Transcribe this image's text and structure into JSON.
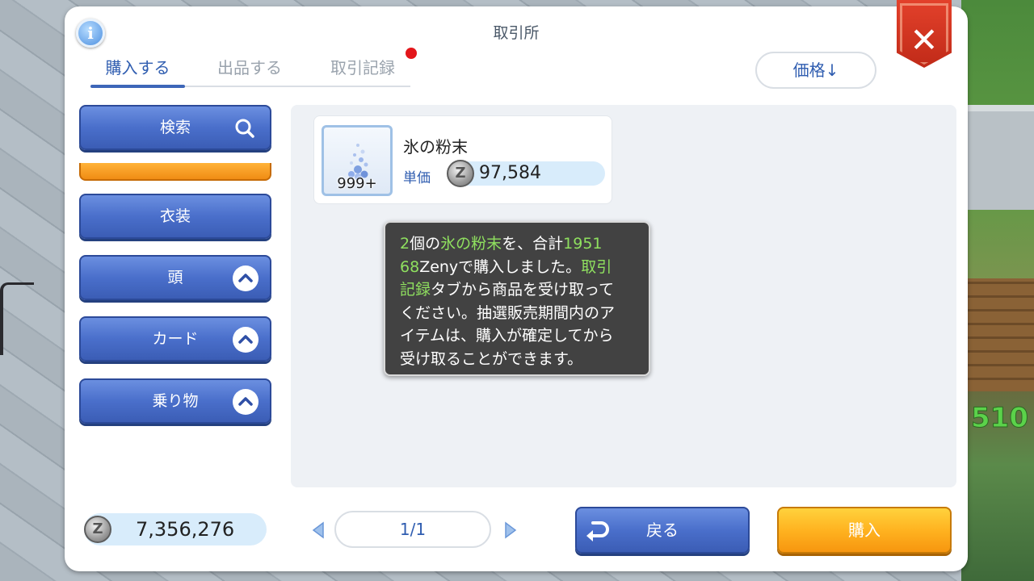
{
  "window": {
    "title": "取引所",
    "close_symbol": "✕",
    "info_symbol": "i"
  },
  "tabs": [
    {
      "label": "購入する",
      "active": true
    },
    {
      "label": "出品する",
      "active": false
    },
    {
      "label": "取引記録",
      "active": false,
      "has_notification": true
    }
  ],
  "sort": {
    "label": "価格↓"
  },
  "sidebar": {
    "search_label": "検索",
    "categories": [
      {
        "label": "衣装",
        "expandable": false
      },
      {
        "label": "頭",
        "expandable": true
      },
      {
        "label": "カード",
        "expandable": true
      },
      {
        "label": "乗り物",
        "expandable": true
      }
    ]
  },
  "listing": {
    "item_name": "氷の粉末",
    "quantity": "999+",
    "price_label": "単価",
    "price": "97,584",
    "currency_symbol": "Z"
  },
  "toast": {
    "line1_a": "2",
    "line1_b": "個の",
    "line1_c": "氷の粉末",
    "line1_d": "を、合計",
    "line1_e": "1951",
    "line2_a": "68",
    "line2_b": "Zenyで購入しました。",
    "line2_c": "取引",
    "line3_a": "記録",
    "line3_b": "タブから商品を受け取って",
    "line4": "ください。抽選販売期間内のア",
    "line5": "イテムは、購入が確定してから",
    "line6": "受け取ることができます。"
  },
  "wallet": {
    "zeny": "7,356,276",
    "currency_symbol": "Z"
  },
  "pagination": {
    "label": "1/1"
  },
  "actions": {
    "back_label": "戻る",
    "buy_label": "購入"
  },
  "background": {
    "damage_number": "510"
  },
  "colors": {
    "accent_blue": "#3d66b8",
    "button_blue": "#4a6fcb",
    "button_orange": "#ffb320",
    "close_red": "#d8351f",
    "toast_highlight": "#8fe05f",
    "notification_red": "#e3161b"
  }
}
